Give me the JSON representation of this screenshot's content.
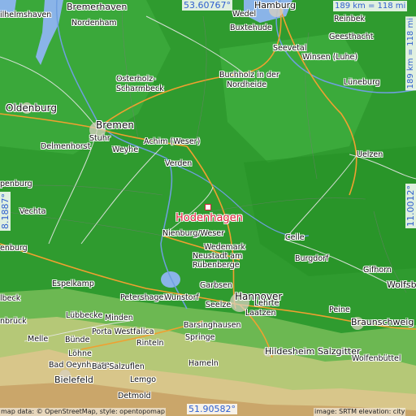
{
  "map": {
    "target": {
      "name": "Hodenhagen",
      "marker_color": "#d0233a"
    },
    "coords": {
      "top_latitude": "53.60767°",
      "bottom_latitude": "51.90582°",
      "left_longitude": "8.1887°",
      "right_longitude": "11.0012°",
      "scale_horizontal": "189 km = 118 mi",
      "scale_vertical": "189 km = 118 mi"
    },
    "cities": [
      "Bremerhaven",
      "Hamburg",
      "Wedel",
      "Reinbek",
      "ilhelmshaven",
      "Nordenham",
      "Buxtehude",
      "Geesthacht",
      "Seevetal",
      "Winsen (Luhe)",
      "Osterholz-",
      "Scharmbeck",
      "Buchholz in der",
      "Nordheide",
      "Lüneburg",
      "Oldenburg",
      "Bremen",
      "Stuhr",
      "Delmenhorst",
      "Weyhe",
      "Achim (Weser)",
      "Uelzen",
      "Verden",
      "Vechta",
      "Nienburg/Weser",
      "Celle",
      "Wedemark",
      "Neustadt am",
      "Rübenberge",
      "Burgdorf",
      "Gifhorn",
      "Espelkamp",
      "Petershagen",
      "Wunstorf",
      "Garbsen",
      "Hannover",
      "Seelze",
      "Lehrte",
      "Wolfsb",
      "Lübbecke",
      "Minden",
      "Laatzen",
      "Peine",
      "Braunschweig",
      "Melle",
      "Bünde",
      "Porta Westfalica",
      "Barsinghausen",
      "Springe",
      "Löhne",
      "Bad Oeynhausen",
      "Rinteln",
      "Hildesheim",
      "Salzgitter",
      "Wolfenbüttel",
      "Bad Salzuflen",
      "Bielefeld",
      "Hameln",
      "Lemgo",
      "Detmold",
      "nbrück",
      "penburg",
      "enburg",
      "lbeck"
    ],
    "attribution_left": "map data: © OpenStreetMap, style: opentopomap",
    "attribution_right": "image: SRTM elevation: city"
  }
}
